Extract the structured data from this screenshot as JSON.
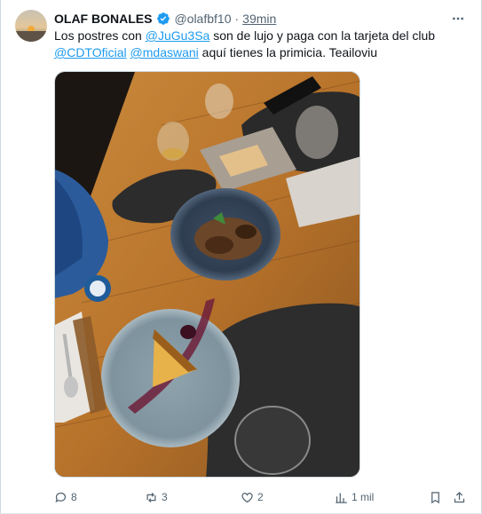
{
  "tweet": {
    "author_name": "OLAF BONALES",
    "handle": "@olafbf10",
    "separator": "·",
    "time": "39min",
    "text_parts": {
      "p1": "Los postres con ",
      "m1": "@JuGu3Sa",
      "p2": " son de lujo y paga con la tarjeta del club",
      "m2": "@CDTOficial",
      "p3": " ",
      "m3": "@mdaswani",
      "p4": " aquí tienes la primicia. Teailoviu"
    },
    "colors": {
      "accent": "#1d9bf0",
      "secondary_text": "#536471",
      "verified": "#1d9bf0"
    }
  },
  "actions": {
    "replies": "8",
    "retweets": "3",
    "likes": "2",
    "views": "1 mil"
  },
  "icons": [
    "verified-badge-icon",
    "more-icon",
    "reply-icon",
    "retweet-icon",
    "like-icon",
    "views-icon",
    "bookmark-icon",
    "share-icon"
  ]
}
